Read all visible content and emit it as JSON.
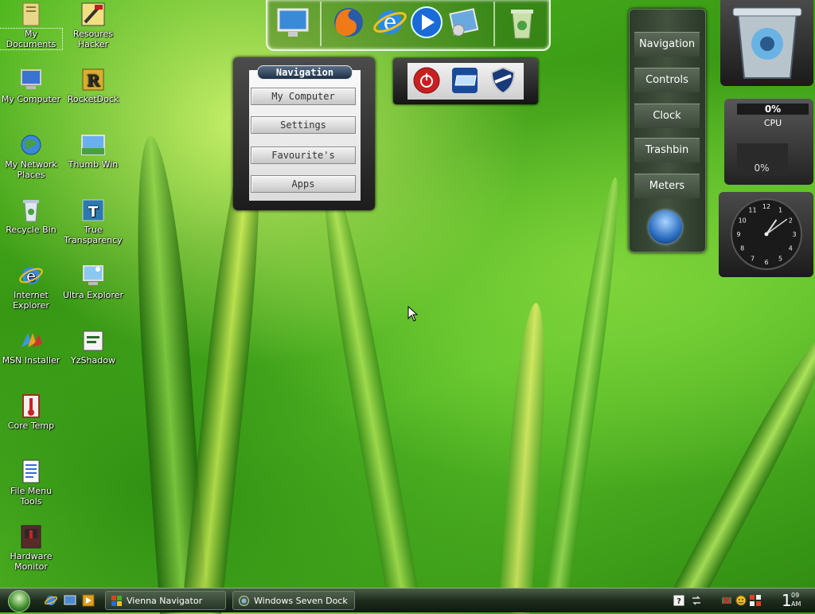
{
  "desktop_icons": [
    {
      "label": "My Documents",
      "icon": "folder-documents-icon"
    },
    {
      "label": "Resoures Hacker",
      "icon": "resource-hacker-icon"
    },
    {
      "label": "My Computer",
      "icon": "computer-icon"
    },
    {
      "label": "RocketDock",
      "icon": "rocketdock-icon"
    },
    {
      "label": "My Network Places",
      "icon": "network-places-icon"
    },
    {
      "label": "Thumb Win",
      "icon": "thumb-win-icon"
    },
    {
      "label": "Recycle Bin",
      "icon": "recycle-bin-icon"
    },
    {
      "label": "True Transparency",
      "icon": "true-transparency-icon"
    },
    {
      "label": "Internet Explorer",
      "icon": "internet-explorer-icon"
    },
    {
      "label": "Ultra Explorer",
      "icon": "ultra-explorer-icon"
    },
    {
      "label": "MSN Installer",
      "icon": "msn-icon"
    },
    {
      "label": "YzShadow",
      "icon": "yzshadow-icon"
    },
    {
      "label": "Core Temp",
      "icon": "thermometer-icon"
    },
    {
      "label": "File Menu Tools",
      "icon": "file-menu-tools-icon"
    },
    {
      "label": "Hardware Monitor",
      "icon": "hardware-monitor-icon"
    }
  ],
  "top_dock": {
    "items": [
      "monitor-icon",
      "firefox-icon",
      "internet-explorer-icon",
      "media-player-icon",
      "control-panel-icon",
      "trash-icon"
    ]
  },
  "navigation_panel": {
    "title": "Navigation",
    "buttons": [
      "My Computer",
      "Settings",
      "Favourite's",
      "Apps"
    ]
  },
  "controls_panel": {
    "buttons": [
      "power-icon",
      "window-icon",
      "shield-icon"
    ]
  },
  "side_menu": {
    "items": [
      "Navigation",
      "Controls",
      "Clock",
      "Trashbin",
      "Meters"
    ]
  },
  "cpu_meter": {
    "top_value": "0%",
    "label": "CPU",
    "bottom_value": "0%"
  },
  "analog_clock": {
    "numerals": [
      "12",
      "1",
      "2",
      "3",
      "4",
      "5",
      "6",
      "7",
      "8",
      "9",
      "10",
      "11"
    ],
    "hour": 1,
    "minute": 9
  },
  "taskbar": {
    "tasks": [
      "Vienna Navigator",
      "Windows Seven Dock"
    ],
    "clock_hour": "1",
    "clock_minute": "09",
    "clock_ampm": "AM"
  },
  "colors": {
    "accent_green": "#4fb81f",
    "nav_title_bg": "#2a3f57",
    "panel_dark": "#1c1c1c",
    "taskbar_dark": "#1e2d1e"
  }
}
